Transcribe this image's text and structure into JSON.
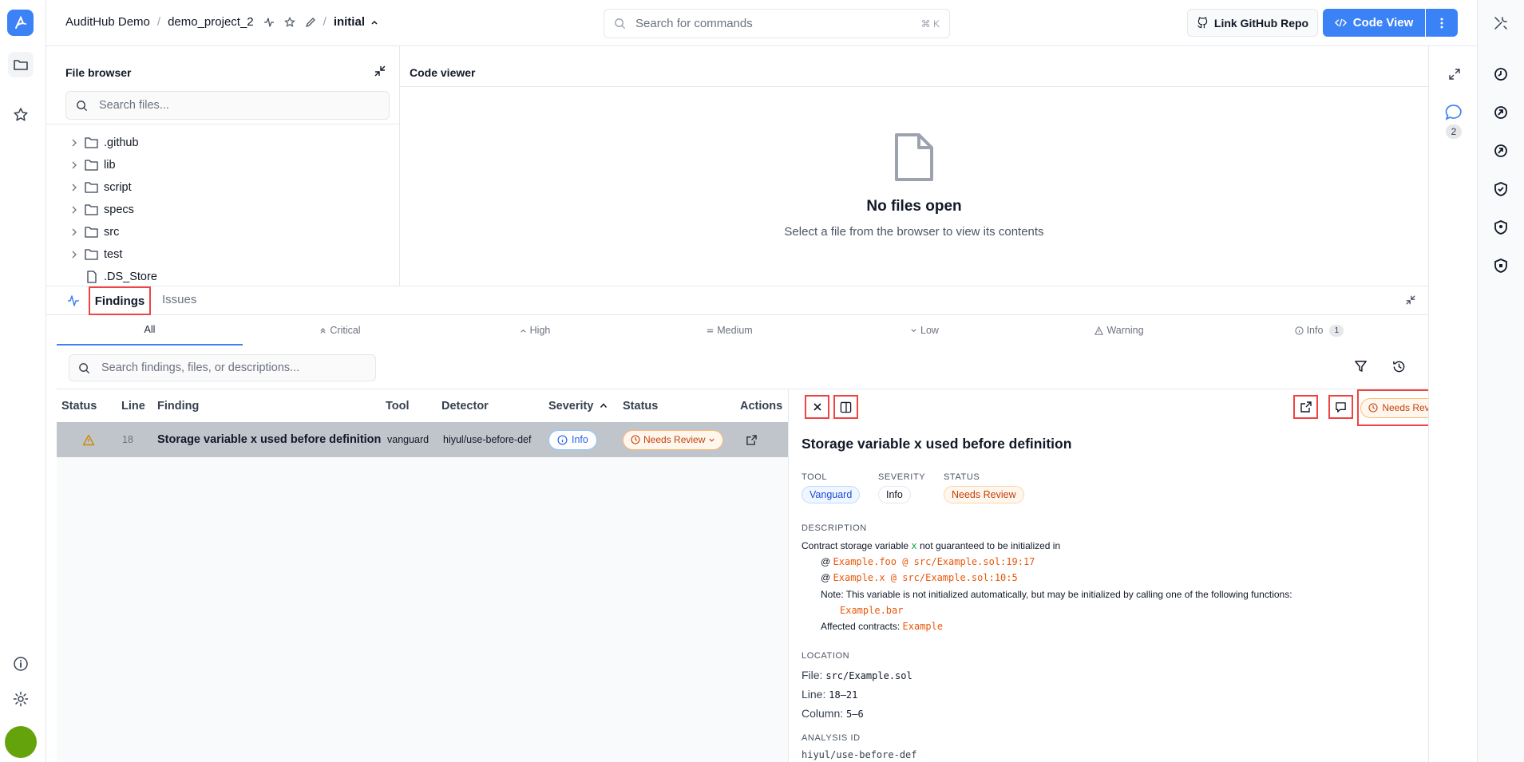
{
  "header": {
    "org": "AuditHub Demo",
    "project": "demo_project_2",
    "version": "initial",
    "search_placeholder": "Search for commands",
    "search_shortcut": "⌘ K",
    "link_github": "Link GitHub Repo",
    "code_view": "Code View"
  },
  "file_browser": {
    "title": "File browser",
    "search_placeholder": "Search files...",
    "items": [
      ".github",
      "lib",
      "script",
      "specs",
      "src",
      "test",
      ".DS_Store"
    ]
  },
  "code_viewer": {
    "title": "Code viewer",
    "empty_title": "No files open",
    "empty_subtitle": "Select a file from the browser to view its contents"
  },
  "side_strip": {
    "comment_count": "2"
  },
  "findings_panel": {
    "tabs": {
      "findings": "Findings",
      "issues": "Issues"
    },
    "severity_tabs": [
      "All",
      "Critical",
      "High",
      "Medium",
      "Low",
      "Warning",
      "Info"
    ],
    "info_count": "1",
    "search_placeholder": "Search findings, files, or descriptions...",
    "columns": [
      "Status",
      "Line",
      "Finding",
      "Tool",
      "Detector",
      "Severity",
      "Status",
      "Actions"
    ],
    "rows": [
      {
        "line": "18",
        "finding": "Storage variable x used before definition",
        "tool": "vanguard",
        "detector": "hiyul/use-before-def",
        "severity": "Info",
        "status": "Needs Review"
      }
    ]
  },
  "detail": {
    "status_button": "Needs Review",
    "title": "Storage variable x used before definition",
    "tool_label": "TOOL",
    "tool": "Vanguard",
    "severity_label": "SEVERITY",
    "severity": "Info",
    "status_label": "STATUS",
    "status": "Needs Review",
    "description_label": "DESCRIPTION",
    "desc_line1_pre": "Contract storage variable",
    "desc_var": "x",
    "desc_line1_post": "not guaranteed to be initialized in",
    "desc_at1": "@",
    "desc_ref1": "Example.foo @ src/Example.sol:19:17",
    "desc_at2": "@",
    "desc_ref2": "Example.x @ src/Example.sol:10:5",
    "desc_note": "Note: This variable is not initialized automatically, but may be initialized by calling one of the following functions:",
    "desc_fn": "Example.bar",
    "desc_affected": "Affected contracts:",
    "desc_contract": "Example",
    "location_label": "LOCATION",
    "file_label": "File:",
    "file": "src/Example.sol",
    "line_label": "Line:",
    "line": "18–21",
    "column_label": "Column:",
    "column": "5–6",
    "analysis_label": "ANALYSIS ID",
    "analysis_id": "hiyul/use-before-def"
  },
  "colors": {
    "accent": "#3b82f6",
    "highlight": "#ef4444",
    "review": "#c2410c"
  }
}
